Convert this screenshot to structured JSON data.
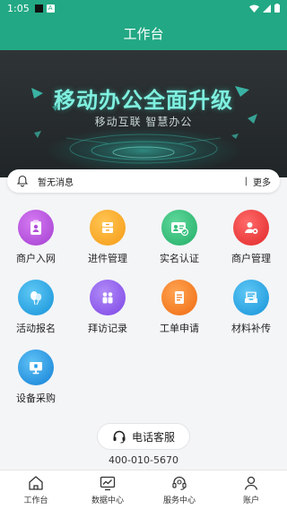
{
  "status_bar": {
    "time": "1:05",
    "badge_glyph": "A"
  },
  "header": {
    "title": "工作台"
  },
  "banner": {
    "headline": "移动办公全面升级",
    "subtitle": "移动互联  智慧办公"
  },
  "notice": {
    "text": "暂无消息",
    "separator": "|",
    "more_label": "更多"
  },
  "grid": {
    "items": [
      {
        "label": "商户入网",
        "icon": "clipboard-person-icon",
        "color": "#b04fd6"
      },
      {
        "label": "进件管理",
        "icon": "drawer-icon",
        "color": "#f5a623"
      },
      {
        "label": "实名认证",
        "icon": "id-card-icon",
        "color": "#2fbf7a"
      },
      {
        "label": "商户管理",
        "icon": "person-gear-icon",
        "color": "#ee3b3b"
      },
      {
        "label": "活动报名",
        "icon": "balloons-icon",
        "color": "#1ea7e8"
      },
      {
        "label": "拜访记录",
        "icon": "people-icon",
        "color": "#8b5cf0"
      },
      {
        "label": "工单申请",
        "icon": "document-icon",
        "color": "#f57c1f"
      },
      {
        "label": "材料补传",
        "icon": "upload-tray-icon",
        "color": "#1ea7e8"
      },
      {
        "label": "设备采购",
        "icon": "monitor-icon",
        "color": "#1e9be8"
      }
    ]
  },
  "hotline": {
    "label": "电话客服",
    "number": "400-010-5670"
  },
  "tabs": [
    {
      "label": "工作台",
      "icon": "home-icon"
    },
    {
      "label": "数据中心",
      "icon": "chart-icon"
    },
    {
      "label": "服务中心",
      "icon": "headset-icon"
    },
    {
      "label": "账户",
      "icon": "user-icon"
    }
  ],
  "colors": {
    "brand": "#22a884",
    "banner_text": "#7ff0df"
  }
}
